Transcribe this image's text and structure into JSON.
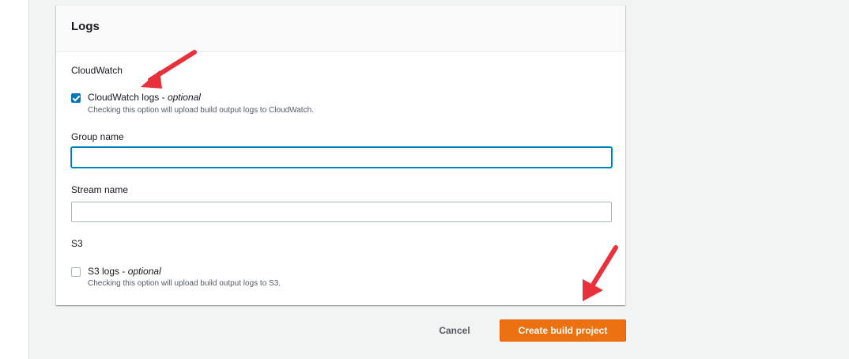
{
  "logs_panel": {
    "title": "Logs",
    "cloudwatch": {
      "section_label": "CloudWatch",
      "checkbox_label": "CloudWatch logs - ",
      "checkbox_optional": "optional",
      "checkbox_checked": true,
      "checkbox_description": "Checking this option will upload build output logs to CloudWatch.",
      "group_name_label": "Group name",
      "group_name_value": "",
      "stream_name_label": "Stream name",
      "stream_name_value": ""
    },
    "s3": {
      "section_label": "S3",
      "checkbox_label": "S3 logs - ",
      "checkbox_optional": "optional",
      "checkbox_checked": false,
      "checkbox_description": "Checking this option will upload build output logs to S3."
    }
  },
  "footer": {
    "cancel_label": "Cancel",
    "create_label": "Create build project"
  },
  "colors": {
    "primary_button": "#ec7211",
    "checkbox_checked": "#0073bb",
    "focus_ring": "#00a1c9",
    "annotation_arrow": "#e8313a"
  },
  "annotations": [
    "arrow-pointing-to-cloudwatch-checkbox",
    "arrow-pointing-to-create-button"
  ]
}
